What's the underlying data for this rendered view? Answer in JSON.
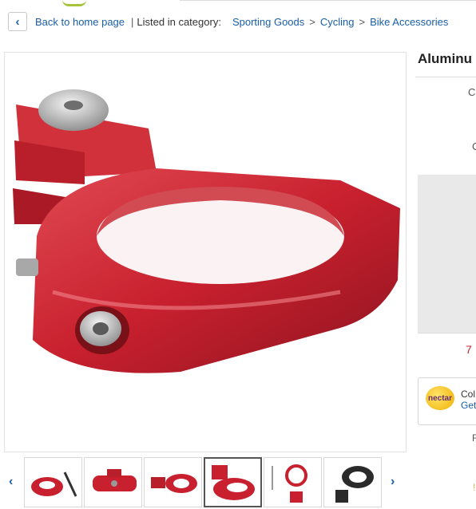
{
  "breadcrumb": {
    "back_label": "Back to home page",
    "listed_label": "Listed in category:",
    "categories": [
      "Sporting Goods",
      "Cycling",
      "Bike Accessories"
    ],
    "separator": ">"
  },
  "product": {
    "title_visible": "Aluminu",
    "cut_labels": [
      "C",
      "C",
      "F"
    ],
    "price_cut": "7",
    "accent_color": "#c8202e"
  },
  "nectar": {
    "logo_text": "nectar",
    "line1": "Col",
    "line2": "Get"
  },
  "thumbnails": {
    "count": 6,
    "selected_index": 3,
    "prev_icon": "chevron-left-icon",
    "next_icon": "chevron-right-icon"
  }
}
